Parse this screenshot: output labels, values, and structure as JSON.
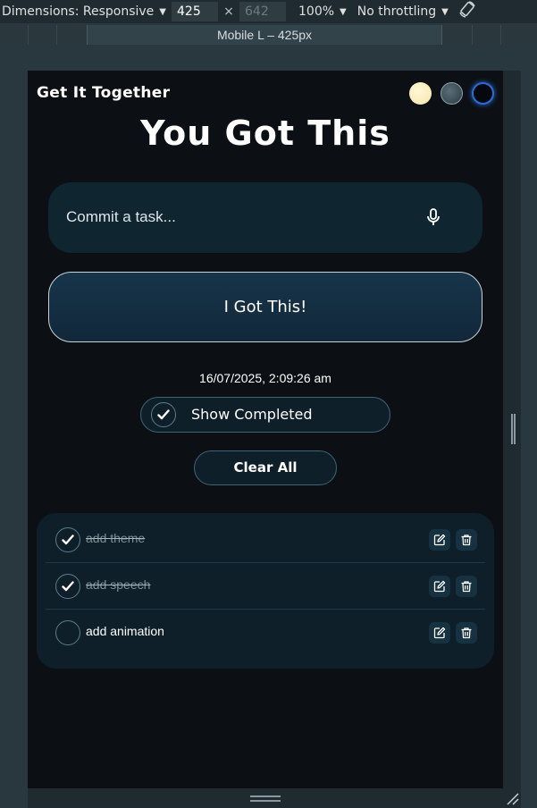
{
  "devtools": {
    "dimensions_label": "Dimensions: Responsive",
    "width_value": "425",
    "height_value": "642",
    "times": "×",
    "zoom": "100%",
    "throttling": "No throttling",
    "breakpoint_label": "Mobile L – 425px"
  },
  "app": {
    "brand": "Get It Together",
    "headline": "You Got This",
    "task_input_placeholder": "Commit a task...",
    "submit_label": "I Got This!",
    "timestamp": "16/07/2025, 2:09:26 am",
    "show_completed_label": "Show Completed",
    "clear_all_label": "Clear All",
    "themes": [
      {
        "name": "light",
        "color": "#f7ecbd"
      },
      {
        "name": "slate",
        "color": "#3d4f58"
      },
      {
        "name": "dark",
        "color": "#05080d",
        "selected": true
      }
    ],
    "tasks": [
      {
        "text": "add theme",
        "completed": true
      },
      {
        "text": "add speech",
        "completed": true
      },
      {
        "text": "add animation",
        "completed": false
      }
    ]
  },
  "colors": {
    "background": "#0c1014",
    "card": "#0f1f29",
    "input": "#0f2530",
    "accent_border": "#3f6474",
    "selected_theme_ring": "#2a6bd8"
  }
}
